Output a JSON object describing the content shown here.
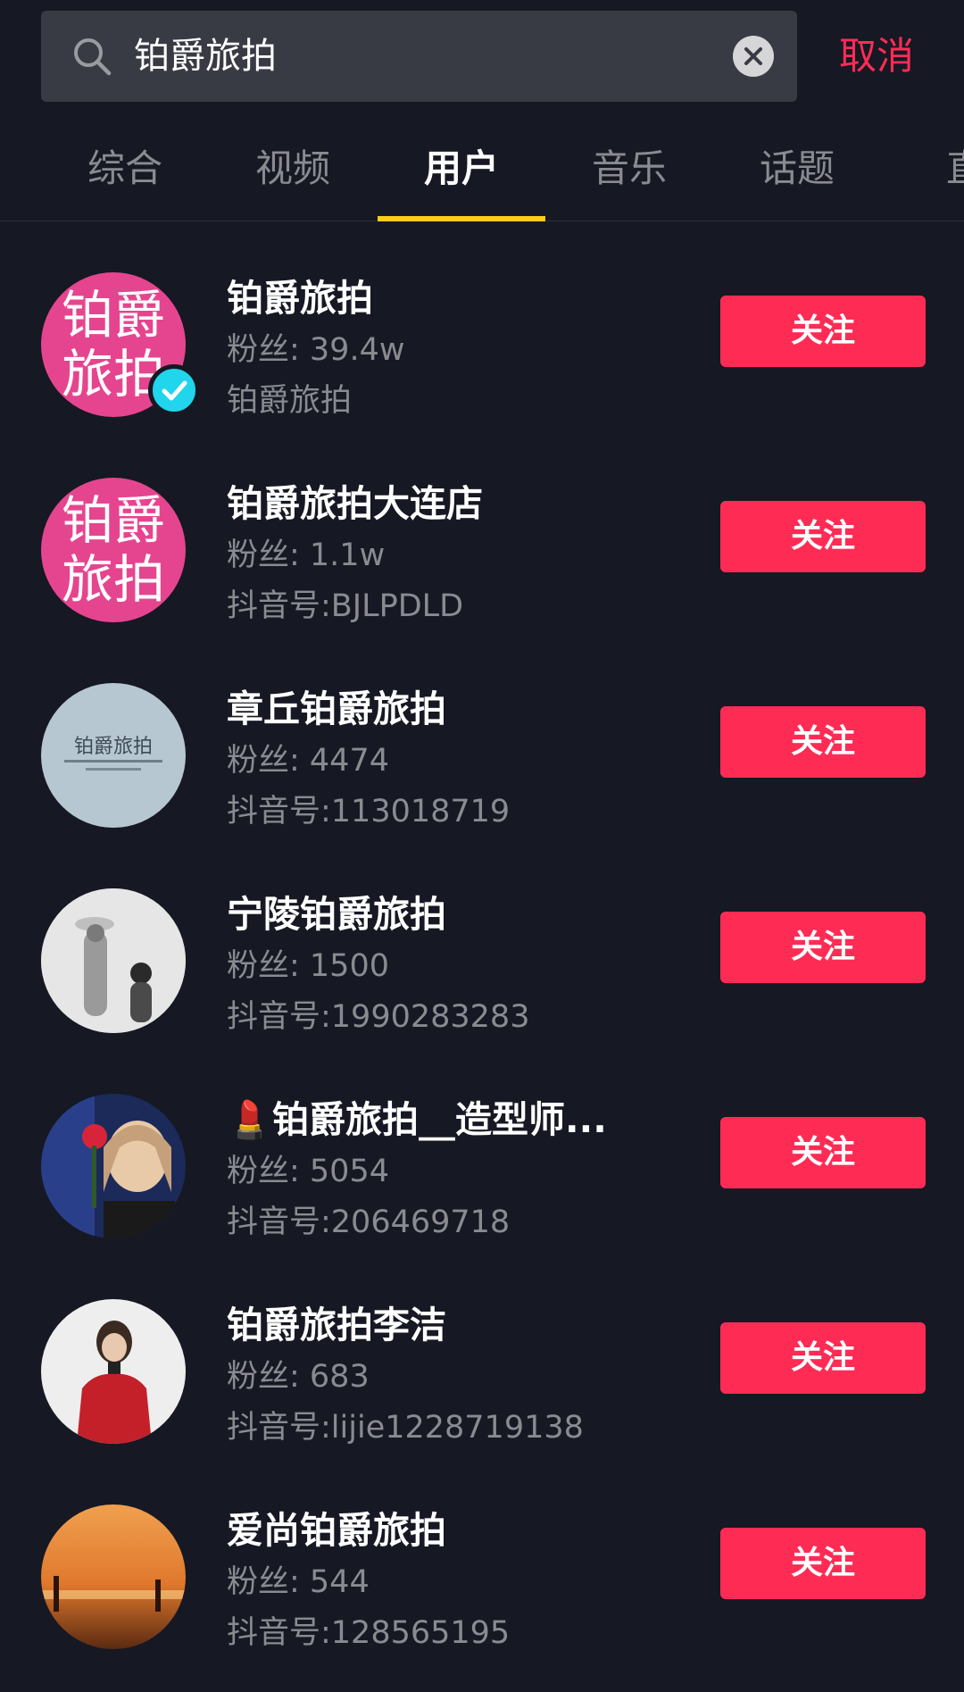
{
  "search": {
    "query": "铂爵旅拍",
    "cancel_label": "取消"
  },
  "tabs": [
    {
      "label": "综合"
    },
    {
      "label": "视频"
    },
    {
      "label": "用户",
      "active": true
    },
    {
      "label": "音乐"
    },
    {
      "label": "话题"
    },
    {
      "label": "直"
    }
  ],
  "accent": "#fe2c55",
  "users": [
    {
      "name": "铂爵旅拍",
      "fans": "粉丝: 39.4w",
      "sub": "铂爵旅拍",
      "follow": "关注",
      "avatar_text": "铂爵旅拍",
      "verified": true
    },
    {
      "name": "铂爵旅拍大连店",
      "fans": "粉丝: 1.1w",
      "sub": "抖音号:BJLPDLD",
      "follow": "关注",
      "avatar_text": "铂爵旅拍"
    },
    {
      "name": "章丘铂爵旅拍",
      "fans": "粉丝: 4474",
      "sub": "抖音号:113018719",
      "follow": "关注",
      "avatar_text": "铂爵旅拍"
    },
    {
      "name": "宁陵铂爵旅拍",
      "fans": "粉丝: 1500",
      "sub": "抖音号:1990283283",
      "follow": "关注"
    },
    {
      "name": "💄铂爵旅拍__造型师...",
      "fans": "粉丝: 5054",
      "sub": "抖音号:206469718",
      "follow": "关注"
    },
    {
      "name": "铂爵旅拍李洁",
      "fans": "粉丝: 683",
      "sub": "抖音号:lijie1228719138",
      "follow": "关注"
    },
    {
      "name": "爱尚铂爵旅拍",
      "fans": "粉丝: 544",
      "sub": "抖音号:128565195",
      "follow": "关注"
    }
  ]
}
